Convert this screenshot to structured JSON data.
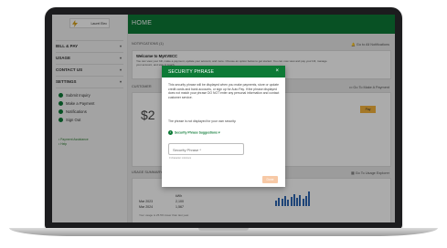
{
  "app": {
    "logo_text": "Laurel Elec",
    "page_title": "HOME"
  },
  "sidebar": {
    "nav": [
      {
        "label": "BILL & PAY"
      },
      {
        "label": "USAGE"
      },
      {
        "label": "CONTACT US"
      },
      {
        "label": "SETTINGS"
      }
    ],
    "quick_actions": [
      {
        "label": "Submit Inquiry",
        "color": "#0d7a36"
      },
      {
        "label": "Make a Payment",
        "color": "#0d7a36"
      },
      {
        "label": "Notifications",
        "color": "#0d7a36"
      },
      {
        "label": "Sign Out",
        "color": "#0d7a36"
      }
    ],
    "links": [
      "Payment Assistance",
      "Help"
    ]
  },
  "main": {
    "notifications_header": "NOTIFICATIONS (1)",
    "notifications_link": "Go to All Notifications",
    "welcome_title": "Welcome to MyKVECC",
    "welcome_text": "You can view your bill, make a payment, update your account, and more. Choose an option below to get started. You can now view and pay your bill, manage your account, and stay in touch.",
    "customer_header": "CUSTOMER",
    "make_payment_link": "Go To Make A Payment",
    "amount": "$2",
    "pay_label": "Pay",
    "usage_header": "USAGE SUMMARY",
    "usage_link": "Go To Usage Explorer",
    "usage_title": "BRANCH, AR 72045",
    "usage_col": "kWh",
    "usage_rows": [
      {
        "label": "Mar 2023",
        "value": "2,100"
      },
      {
        "label": "Mar 2024",
        "value": "1,567"
      }
    ],
    "usage_note": "Your usage is 25.5% lower than last year.",
    "bar_values": [
      0.35,
      0.5,
      0.45,
      0.6,
      0.4,
      0.55,
      0.7,
      0.5,
      0.65,
      0.45,
      0.6,
      0.9
    ]
  },
  "modal": {
    "title": "SECURITY PHRASE",
    "close_glyph": "×",
    "para1": "This security phrase will be displayed when you make payments, store or update credit cards and bank accounts, or sign up for Auto Pay. If the phrase displayed does not match your phrase DO NOT enter any personal information and contact customer service.",
    "para2": "The phrase is not displayed for your own security.",
    "suggestions_label": "Security Phrase Suggestions",
    "suggestions_glyph": "▾",
    "input_placeholder": "Security Phrase *",
    "hint": "0 character minimum",
    "done_label": "Done"
  }
}
